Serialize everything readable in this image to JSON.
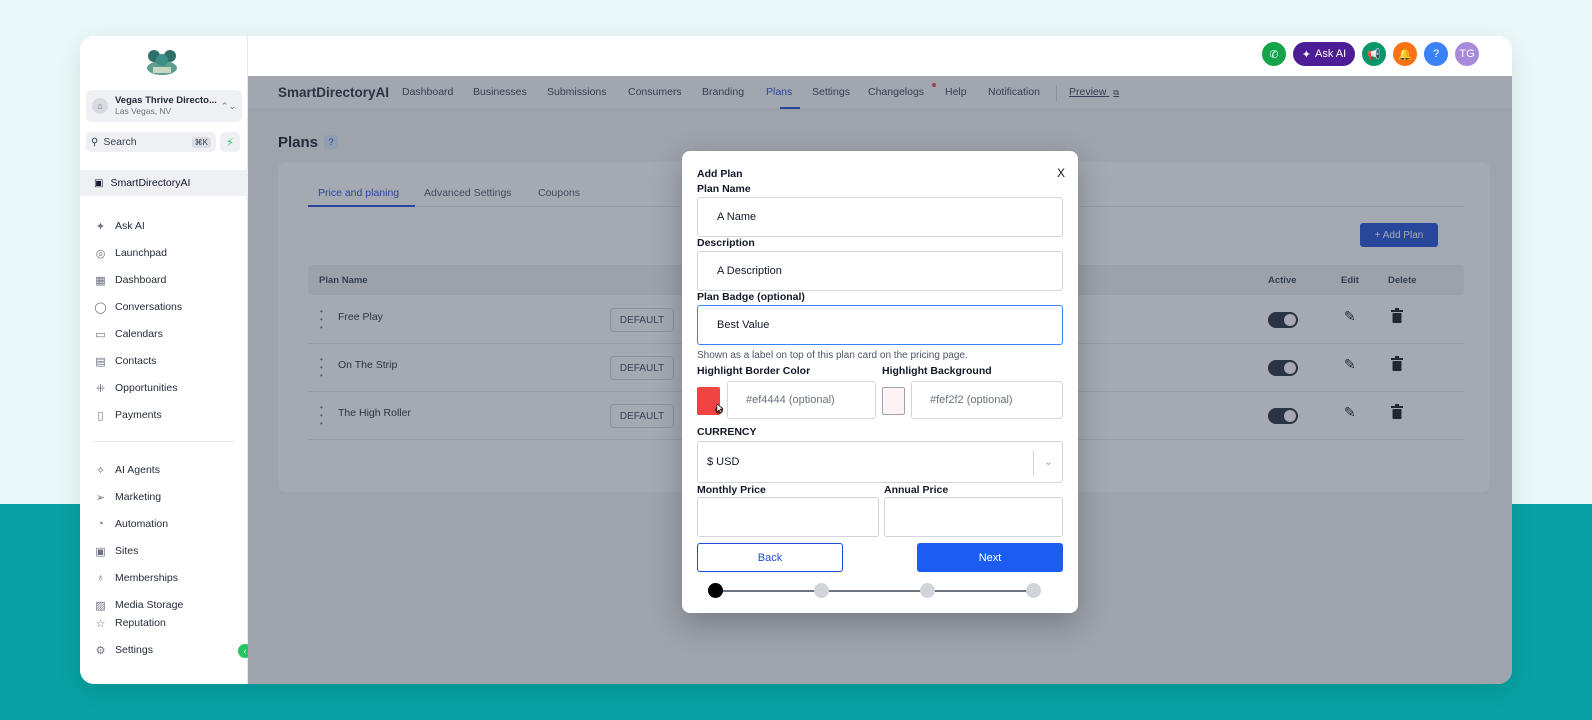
{
  "sidebar": {
    "account": {
      "name": "Vegas Thrive Directo...",
      "location": "Las Vegas, NV"
    },
    "search": {
      "label": "Search",
      "shortcut": "⌘K"
    },
    "selected": "SmartDirectoryAI",
    "items": [
      {
        "label": "Ask AI",
        "icon": "sparkle-icon"
      },
      {
        "label": "Launchpad",
        "icon": "rocket-icon"
      },
      {
        "label": "Dashboard",
        "icon": "grid-icon"
      },
      {
        "label": "Conversations",
        "icon": "chat-icon"
      },
      {
        "label": "Calendars",
        "icon": "calendar-icon"
      },
      {
        "label": "Contacts",
        "icon": "contact-icon"
      },
      {
        "label": "Opportunities",
        "icon": "network-icon"
      },
      {
        "label": "Payments",
        "icon": "receipt-icon"
      },
      {
        "label": "AI Agents",
        "icon": "ai-agent-icon"
      },
      {
        "label": "Marketing",
        "icon": "send-icon"
      },
      {
        "label": "Automation",
        "icon": "automation-icon"
      },
      {
        "label": "Sites",
        "icon": "sites-icon"
      },
      {
        "label": "Memberships",
        "icon": "badge-icon"
      },
      {
        "label": "Media Storage",
        "icon": "image-icon"
      },
      {
        "label": "Reputation",
        "icon": "star-icon"
      }
    ],
    "settings": "Settings"
  },
  "header": {
    "ask_ai": "Ask AI",
    "avatar": "TG",
    "help": "?"
  },
  "appnav": {
    "brand": "SmartDirectoryAI",
    "links": [
      "Dashboard",
      "Businesses",
      "Submissions",
      "Consumers",
      "Branding",
      "Plans",
      "Settings",
      "Changelogs",
      "Help",
      "Notification"
    ],
    "preview": "Preview"
  },
  "page": {
    "title": "Plans",
    "help": "?",
    "tabs": [
      "Price and planing",
      "Advanced Settings",
      "Coupons"
    ],
    "add_plan": "+ Add Plan",
    "columns": {
      "plan_name": "Plan Name",
      "active": "Active",
      "edit": "Edit",
      "delete": "Delete"
    },
    "rows": [
      {
        "name": "Free Play",
        "tag": "DEFAULT",
        "active": true
      },
      {
        "name": "On The Strip",
        "tag": "DEFAULT",
        "active": true
      },
      {
        "name": "The High Roller",
        "tag": "DEFAULT",
        "active": true
      }
    ]
  },
  "modal": {
    "title": "Add Plan",
    "close": "X",
    "plan_name_label": "Plan Name",
    "plan_name_value": "A Name",
    "description_label": "Description",
    "description_value": "A Description",
    "badge_label": "Plan Badge (optional)",
    "badge_value": "Best Value",
    "badge_help": "Shown as a label on top of this plan card on the pricing page.",
    "border_color_label": "Highlight Border Color",
    "border_color_placeholder": "#ef4444 (optional)",
    "background_label": "Highlight Background",
    "background_placeholder": "#fef2f2 (optional)",
    "currency_label": "CURRENCY",
    "currency_value": "$ USD",
    "monthly_label": "Monthly Price",
    "annual_label": "Annual Price",
    "back": "Back",
    "next": "Next",
    "steps_total": 4,
    "step_current": 1
  },
  "colors": {
    "accent": "#1d4ed8",
    "swatch_border": "#ef4444",
    "swatch_bg": "#fef2f2",
    "teal": "#08a1a3"
  }
}
